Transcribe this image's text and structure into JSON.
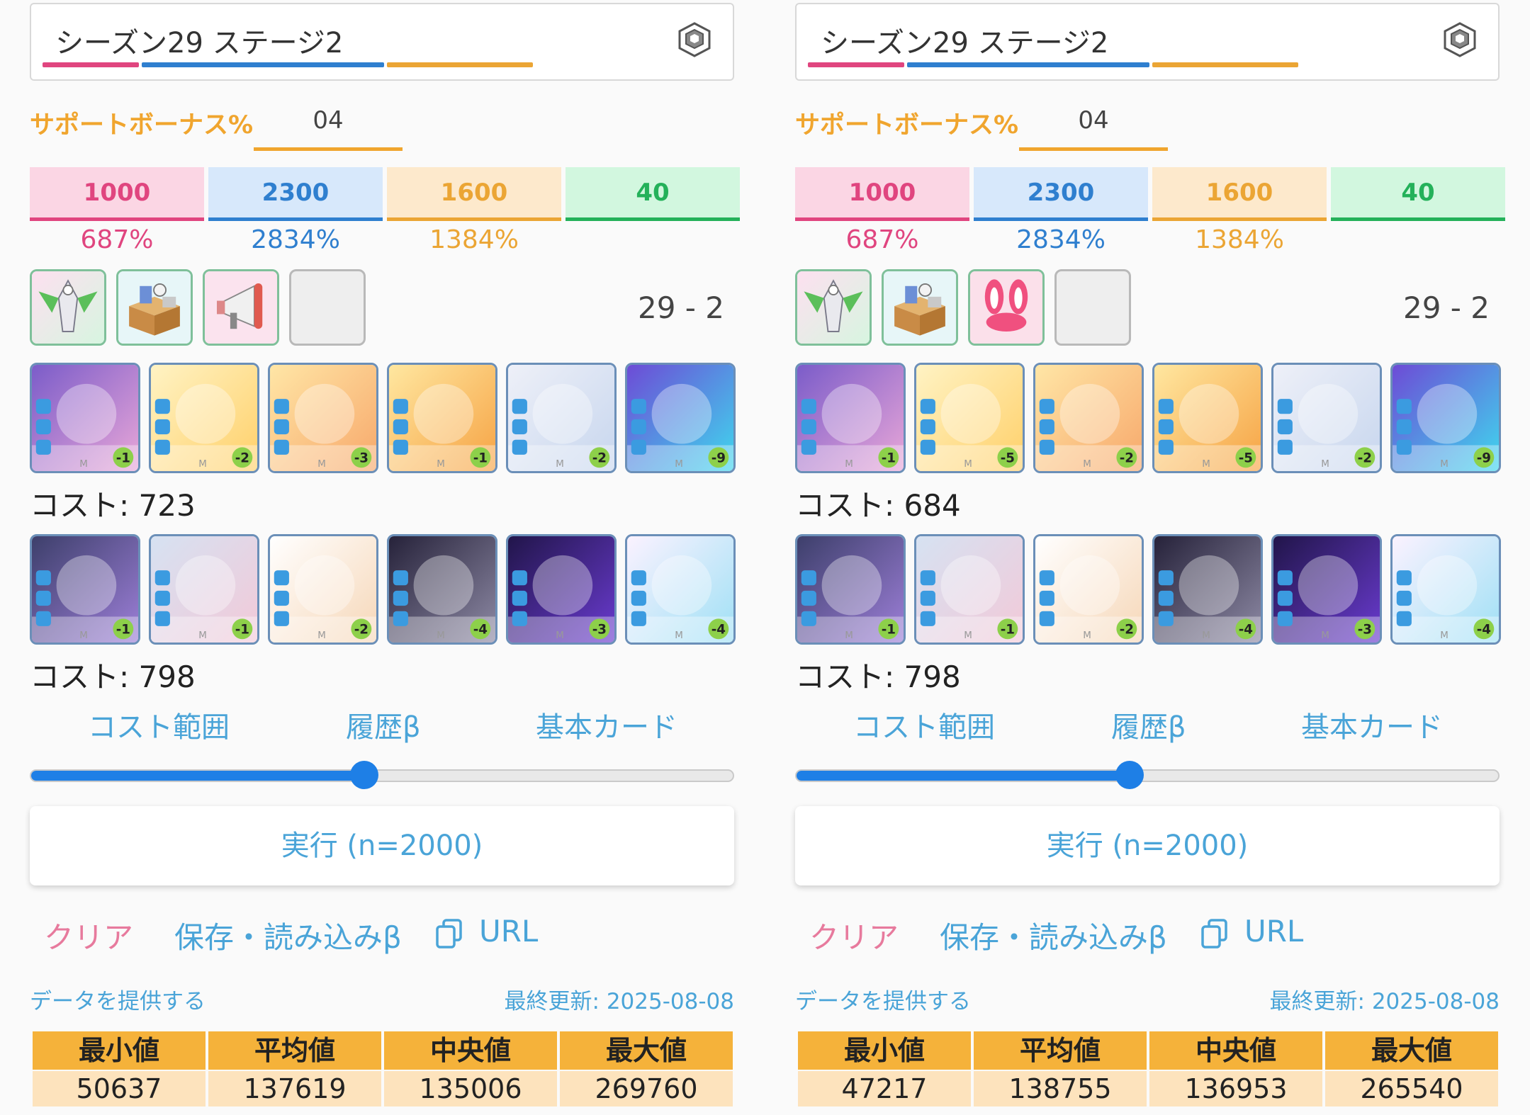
{
  "panels": [
    {
      "header": {
        "title": "シーズン29 ステージ2",
        "icon": "cube-logo-icon"
      },
      "support_bonus": {
        "label": "サポートボーナス%",
        "value": "04"
      },
      "powers": [
        {
          "value": "1000",
          "percent": "687%",
          "color": "#e0457f",
          "bg": "#fbd6e4"
        },
        {
          "value": "2300",
          "percent": "2834%",
          "color": "#2f7fcf",
          "bg": "#d7e8fb"
        },
        {
          "value": "1600",
          "percent": "1384%",
          "color": "#eba534",
          "bg": "#fde9cc"
        },
        {
          "value": "40",
          "percent": "",
          "color": "#24b15a",
          "bg": "#d2f7df"
        }
      ],
      "items": [
        "robot-item",
        "box-item",
        "megaphone-item",
        "empty-slot"
      ],
      "stage": "29 - 2",
      "deck1": {
        "cost_label": "コスト: 723",
        "cards": [
          "-1",
          "-2",
          "-3",
          "-1",
          "-2",
          "-9"
        ]
      },
      "deck2": {
        "cost_label": "コスト: 798",
        "cards": [
          "-1",
          "-1",
          "-2",
          "-4",
          "-3",
          "-4"
        ]
      },
      "links": [
        "コスト範囲",
        "履歴β",
        "基本カード"
      ],
      "slider_level": 0.475,
      "run_label": "実行 (n=2000)",
      "actions": {
        "clear": "クリア",
        "save": "保存・読み込みβ",
        "url": "URL"
      },
      "provide_data": "データを提供する",
      "last_updated": "最終更新: 2025-08-08",
      "stats_headers": [
        "最小値",
        "平均値",
        "中央値",
        "最大値"
      ],
      "stats_values": [
        "50637",
        "137619",
        "135006",
        "269760"
      ]
    },
    {
      "header": {
        "title": "シーズン29 ステージ2",
        "icon": "cube-logo-icon"
      },
      "support_bonus": {
        "label": "サポートボーナス%",
        "value": "04"
      },
      "powers": [
        {
          "value": "1000",
          "percent": "687%",
          "color": "#e0457f",
          "bg": "#fbd6e4"
        },
        {
          "value": "2300",
          "percent": "2834%",
          "color": "#2f7fcf",
          "bg": "#d7e8fb"
        },
        {
          "value": "1600",
          "percent": "1384%",
          "color": "#eba534",
          "bg": "#fde9cc"
        },
        {
          "value": "40",
          "percent": "",
          "color": "#24b15a",
          "bg": "#d2f7df"
        }
      ],
      "items": [
        "robot-item",
        "box-item",
        "bunny-ears-item",
        "empty-slot"
      ],
      "stage": "29 - 2",
      "deck1": {
        "cost_label": "コスト: 684",
        "cards": [
          "-1",
          "-5",
          "-2",
          "-5",
          "-2",
          "-9"
        ]
      },
      "deck2": {
        "cost_label": "コスト: 798",
        "cards": [
          "-1",
          "-1",
          "-2",
          "-4",
          "-3",
          "-4"
        ]
      },
      "links": [
        "コスト範囲",
        "履歴β",
        "基本カード"
      ],
      "slider_level": 0.475,
      "run_label": "実行 (n=2000)",
      "actions": {
        "clear": "クリア",
        "save": "保存・読み込みβ",
        "url": "URL"
      },
      "provide_data": "データを提供する",
      "last_updated": "最終更新: 2025-08-08",
      "stats_headers": [
        "最小値",
        "平均値",
        "中央値",
        "最大値"
      ],
      "stats_values": [
        "47217",
        "138755",
        "136953",
        "265540"
      ]
    }
  ]
}
